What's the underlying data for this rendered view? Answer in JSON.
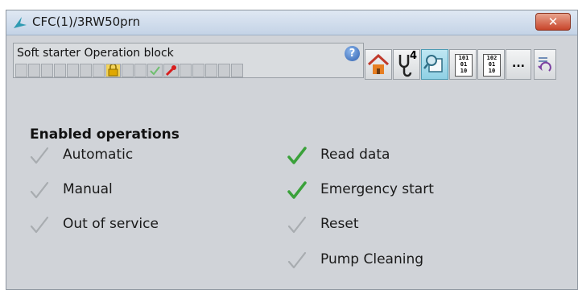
{
  "window": {
    "title": "CFC(1)/3RW50prn",
    "close_label": "✕"
  },
  "block": {
    "name": "Soft starter Operation block",
    "help_label": "?"
  },
  "toolbar": {
    "counter_label": "4",
    "more_label": "...",
    "binary_1": [
      "101",
      "01",
      "10"
    ],
    "binary_2": [
      "102",
      "01",
      "10"
    ]
  },
  "section": {
    "title": "Enabled operations"
  },
  "operations": [
    {
      "label": "Automatic",
      "enabled": false
    },
    {
      "label": "Manual",
      "enabled": false
    },
    {
      "label": "Out of service",
      "enabled": false
    },
    {
      "label": "Read data",
      "enabled": true
    },
    {
      "label": "Emergency start",
      "enabled": true
    },
    {
      "label": "Reset",
      "enabled": false
    },
    {
      "label": "Pump Cleaning",
      "enabled": false
    }
  ],
  "colors": {
    "enabled_check": "#3aa13a",
    "disabled_check": "#a8acb0",
    "title_bar": "#c4d3e6",
    "close": "#c8452b",
    "panel": "#d0d3d8"
  }
}
